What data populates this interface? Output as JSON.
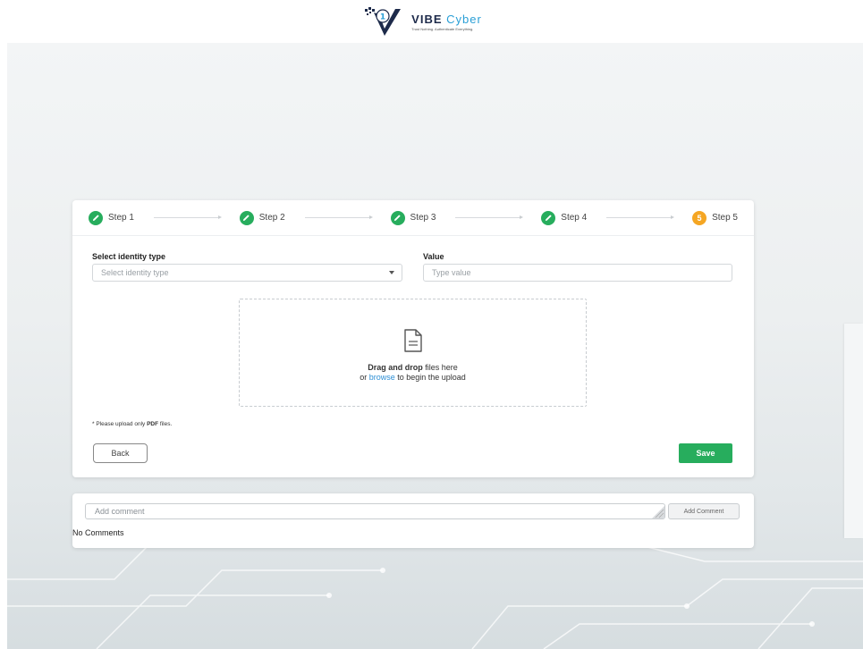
{
  "brand": {
    "name_part1": "VIBE",
    "name_part2": "Cyber",
    "tagline": "Trust Nothing. Authenticate Everything."
  },
  "steps": [
    {
      "label": "Step 1",
      "status": "complete"
    },
    {
      "label": "Step 2",
      "status": "complete"
    },
    {
      "label": "Step 3",
      "status": "complete"
    },
    {
      "label": "Step 4",
      "status": "complete"
    },
    {
      "label": "Step 5",
      "status": "current",
      "badge": "5"
    }
  ],
  "form": {
    "identity_type": {
      "label": "Select identity type",
      "placeholder": "Select identity type"
    },
    "value": {
      "label": "Value",
      "placeholder": "Type value"
    }
  },
  "upload": {
    "drag_bold": "Drag and drop",
    "drag_rest": " files here",
    "or_text": "or ",
    "browse_text": "browse",
    "begin_text": " to begin the upload"
  },
  "note": {
    "prefix": "* Please upload only ",
    "bold": "PDF",
    "suffix": " files."
  },
  "buttons": {
    "back": "Back",
    "save": "Save"
  },
  "comments": {
    "placeholder": "Add comment",
    "add_button": "Add Comment",
    "empty_text": "No Comments"
  },
  "colors": {
    "step_complete": "#27ad5d",
    "step_current": "#f5a623",
    "save_button": "#27ad5d",
    "link": "#2d8fd5"
  }
}
